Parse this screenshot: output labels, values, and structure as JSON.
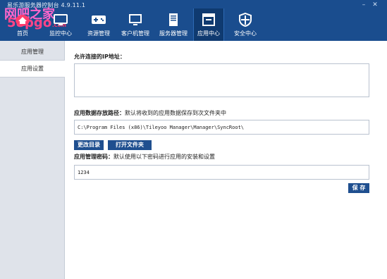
{
  "app": {
    "title": "易乐游服务器控制台 4.9.11.1"
  },
  "watermark": {
    "line1": "网吧之家",
    "line2": "58pgo",
    "line3": ".Com"
  },
  "window_controls": {
    "minimize": "–",
    "close": "✕"
  },
  "nav": [
    {
      "label": "首页",
      "icon": "home-icon"
    },
    {
      "label": "监控中心",
      "icon": "monitor-icon"
    },
    {
      "label": "资源管理",
      "icon": "gamepad-icon"
    },
    {
      "label": "客户机管理",
      "icon": "computer-icon"
    },
    {
      "label": "服务器管理",
      "icon": "server-icon"
    },
    {
      "label": "应用中心",
      "icon": "app-icon"
    },
    {
      "label": "安全中心",
      "icon": "shield-icon"
    }
  ],
  "sidebar": {
    "items": [
      {
        "label": "应用管理"
      },
      {
        "label": "应用设置"
      }
    ]
  },
  "main": {
    "ip_label": "允许连接的IP地址：",
    "ip_value": "",
    "path_label_bold": "应用数据存放路径：",
    "path_label_desc": "默认将收到的应用数据保存到次文件夹中",
    "path_value": "C:\\Program Files (x86)\\Tileyoo Manager\\Manager\\SyncRoot\\",
    "change_dir_button": "更改目录",
    "open_folder_button": "打开文件夹",
    "password_label_bold": "应用管理密码：",
    "password_label_desc": "默认使用以下密码进行应用的安装和设置",
    "password_value": "1234",
    "save_button": "保 存"
  },
  "colors": {
    "header": "#1a4d8e",
    "active_nav": "#0f3a70",
    "button": "#1f4f8f",
    "sidebar": "#dfe3ea"
  }
}
